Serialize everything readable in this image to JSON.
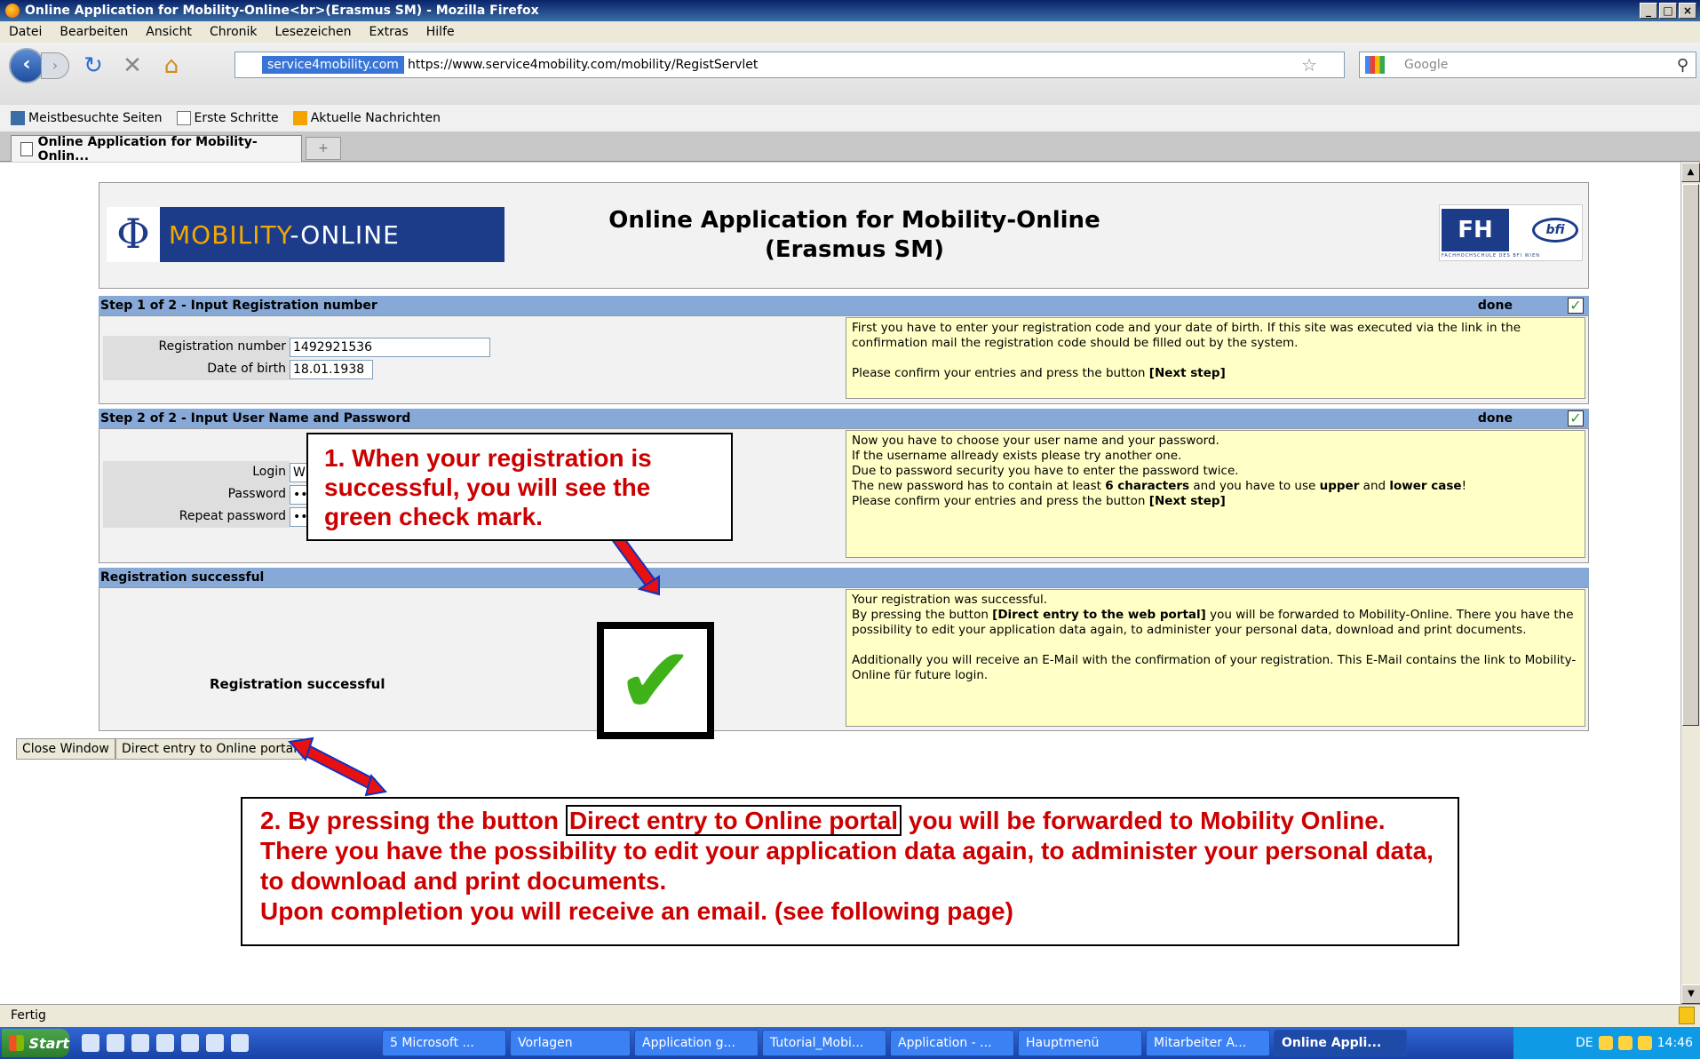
{
  "window": {
    "title": "Online Application for Mobility-Online<br>(Erasmus SM) - Mozilla Firefox",
    "min_label": "_",
    "max_label": "×",
    "restore_label": "□"
  },
  "menu": [
    "Datei",
    "Bearbeiten",
    "Ansicht",
    "Chronik",
    "Lesezeichen",
    "Extras",
    "Hilfe"
  ],
  "nav": {
    "site_badge": "service4mobility.com",
    "url": "https://www.service4mobility.com/mobility/RegistServlet",
    "search_placeholder": "Google"
  },
  "bookmarks": [
    "Meistbesuchte Seiten",
    "Erste Schritte",
    "Aktuelle Nachrichten"
  ],
  "tab": {
    "label": "Online Application for Mobility-Onlin...",
    "new_tab": "+"
  },
  "page": {
    "logo_text_a": "MOBILITY",
    "logo_text_b": "-ONLINE",
    "title_line1": "Online Application for Mobility-Online",
    "title_line2": "(Erasmus SM)",
    "fh_logo_text": "FH",
    "bfi_logo_text": "bfi",
    "fh_logo_sub": "FACHHOCHSCHULE DES BFI WIEN"
  },
  "step1": {
    "title": "Step 1 of 2 - Input Registration number",
    "status": "done",
    "reg_label": "Registration number",
    "reg_value": "1492921536",
    "dob_label": "Date of birth",
    "dob_value": "18.01.1938",
    "info_1": "First you have to enter your registration code and your date of birth. If this site was executed via the link in the confirmation mail the registration code should be filled out by the system.",
    "info_2_prefix": "Please confirm your entries and press the button ",
    "info_2_bold": "[Next step]"
  },
  "step2": {
    "title": "Step 2 of 2 - Input User Name and Password",
    "status": "done",
    "login_label": "Login",
    "login_value": "W",
    "password_label": "Password",
    "password_value": "••",
    "repeat_label": "Repeat password",
    "repeat_value": "••",
    "info_l1": "Now you have to choose your user name and your password.",
    "info_l2": "If the username allready exists please try another one.",
    "info_l3": "Due to password security you have to enter the password twice.",
    "info_l4_a": "The new password has to contain at least ",
    "info_l4_b": "6 characters",
    "info_l4_c": " and you have to use ",
    "info_l4_d": "upper",
    "info_l4_e": " and ",
    "info_l4_f": "lower case",
    "info_l4_g": "!",
    "info_l5_a": "Please confirm your entries and press the button ",
    "info_l5_b": "[Next step]"
  },
  "result": {
    "title": "Registration successful",
    "left_label": "Registration successful",
    "info_l1": "Your registration was successful.",
    "info_l2_a": "By pressing the button ",
    "info_l2_b": "[Direct entry to the web portal]",
    "info_l2_c": " you will be forwarded to Mobility-Online. There you have the possibility to edit your application data again, to administer your personal data, download and print documents.",
    "info_l3": "Additionally you will receive an E-Mail with the confirmation of your registration. This E-Mail contains the link to Mobility-Online für future login."
  },
  "buttons": {
    "close": "Close Window",
    "direct": "Direct entry to Online portal"
  },
  "callouts": {
    "c1": "1. When your registration is successful, you will see the green check mark.",
    "c2_a": "2. By pressing the button ",
    "c2_box": "Direct entry to Online portal",
    "c2_b": " you will be forwarded to Mobility Online. There you have the possibility to edit your application data again, to administer your personal data, to download and print documents.",
    "c2_c": "Upon completion you will receive an email. (see following page)"
  },
  "status": "Fertig",
  "taskbar": {
    "start": "Start",
    "items": [
      "5 Microsoft ...",
      "Vorlagen",
      "Application g...",
      "Tutorial_Mobi...",
      "Application - ...",
      "Hauptmenü",
      "Mitarbeiter A...",
      "Online Appli..."
    ],
    "lang": "DE",
    "clock": "14:46"
  },
  "colors": {
    "step_bar": "#87a9d8",
    "info_bg": "#ffffc6",
    "callout_text": "#cc0000",
    "check_green": "#3fb21a"
  }
}
